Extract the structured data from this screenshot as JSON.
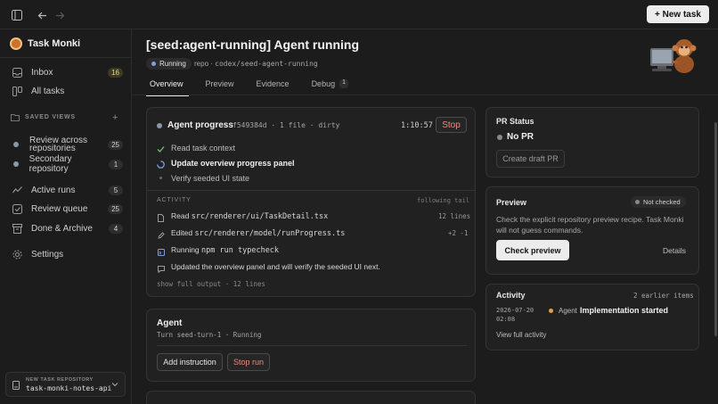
{
  "topbar": {
    "new_task_label": "+ New task"
  },
  "sidebar": {
    "app_name": "Task Monki",
    "nav": [
      {
        "label": "Inbox",
        "badge": "16",
        "icon": "inbox-icon"
      },
      {
        "label": "All tasks",
        "icon": "tasks-icon"
      }
    ],
    "saved_views_title": "SAVED VIEWS",
    "saved_views": [
      {
        "label": "Review across\nrepositories",
        "badge": "25"
      },
      {
        "label": "Secondary repository",
        "badge": "1"
      }
    ],
    "nav2": [
      {
        "label": "Active runs",
        "badge": "5",
        "icon": "activity-icon"
      },
      {
        "label": "Review queue",
        "badge": "25",
        "icon": "check-square-icon"
      },
      {
        "label": "Done & Archive",
        "badge": "4",
        "icon": "archive-icon"
      },
      {
        "label": "Settings",
        "icon": "gear-icon"
      }
    ],
    "repo": {
      "label": "NEW TASK REPOSITORY",
      "value": "task-monki-notes-api"
    }
  },
  "header": {
    "title": "[seed:agent-running] Agent running",
    "status": "Running",
    "repo_label": "repo",
    "repo_sep": "·",
    "repo_value": "codex/seed-agent-running",
    "tabs": [
      {
        "label": "Overview"
      },
      {
        "label": "Preview"
      },
      {
        "label": "Evidence"
      },
      {
        "label": "Debug",
        "count": "1"
      }
    ]
  },
  "progress": {
    "title": "Agent progress",
    "commit": "f549384d",
    "files": "1 file",
    "state": "dirty",
    "sep": "·",
    "timer": "1:10:57",
    "stop_label": "Stop",
    "steps": [
      {
        "label": "Read task context",
        "state": "done"
      },
      {
        "label": "Update overview progress panel",
        "state": "active"
      },
      {
        "label": "Verify seeded UI state",
        "state": "pending"
      }
    ],
    "activity_label": "ACTIVITY",
    "following_label": "following tail",
    "events": [
      {
        "verb": "Read",
        "path": "src/renderer/ui/TaskDetail.tsx",
        "meta": "12 lines",
        "icon": "file-icon"
      },
      {
        "verb": "Edited",
        "path": "src/renderer/model/runProgress.ts",
        "meta": "+2 -1",
        "icon": "pencil-icon"
      },
      {
        "verb": "Running",
        "path": "npm run typecheck",
        "meta": "",
        "icon": "terminal-icon"
      },
      {
        "verb": "Updated the overview panel and will verify the seeded UI next.",
        "path": "",
        "meta": "",
        "icon": "message-icon"
      }
    ],
    "show_full": "show full output · 12 lines"
  },
  "agent": {
    "title": "Agent",
    "turn": "Turn seed-turn-1 · Running",
    "add_instruction": "Add instruction",
    "stop_run": "Stop run"
  },
  "pr": {
    "title": "PR Status",
    "state": "No PR",
    "create_label": "Create draft PR"
  },
  "preview": {
    "title": "Preview",
    "badge": "Not checked",
    "description": "Check the explicit repository preview recipe. Task Monki will not guess commands.",
    "check_label": "Check preview",
    "details_label": "Details"
  },
  "activity": {
    "title": "Activity",
    "earlier": "2 earlier items",
    "date": "2026-07-20",
    "time": "02:08",
    "actor": "Agent",
    "event": "Implementation started",
    "view_all": "View full activity"
  },
  "colors": {
    "accent_running": "#7d9fe0",
    "stop_red": "#f08a7e",
    "done_green": "#6fbf73",
    "activity_orange": "#e0a04a"
  }
}
